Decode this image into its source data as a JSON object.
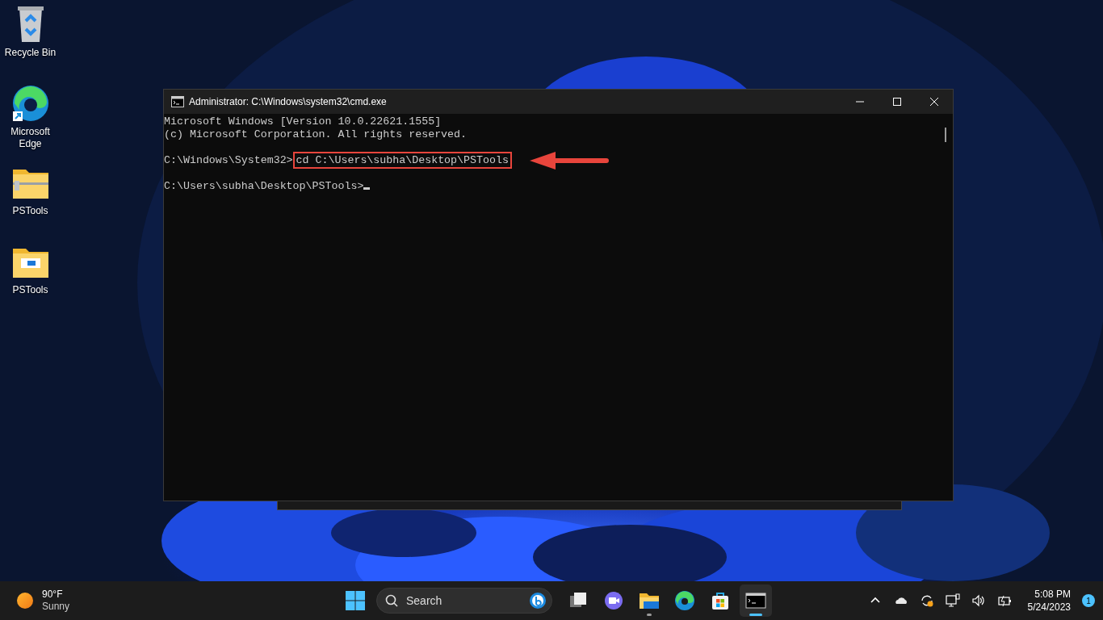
{
  "desktop_icons": [
    {
      "label": "Recycle Bin",
      "kind": "recycle"
    },
    {
      "label": "Microsoft Edge",
      "kind": "edge"
    },
    {
      "label": "PSTools",
      "kind": "zip"
    },
    {
      "label": "PSTools",
      "kind": "folder"
    }
  ],
  "console_window": {
    "title": "Administrator: C:\\Windows\\system32\\cmd.exe",
    "lines": [
      {
        "kind": "output",
        "text": "Microsoft Windows [Version 10.0.22621.1555]"
      },
      {
        "kind": "output",
        "text": "(c) Microsoft Corporation. All rights reserved."
      },
      {
        "kind": "blank"
      },
      {
        "kind": "command",
        "prompt": "C:\\Windows\\System32>",
        "command": "cd C:\\Users\\subha\\Desktop\\PSTools",
        "highlighted": true
      },
      {
        "kind": "blank"
      },
      {
        "kind": "prompt",
        "prompt": "C:\\Users\\subha\\Desktop\\PSTools>",
        "cursor": true
      }
    ]
  },
  "taskbar": {
    "weather": {
      "temperature": "90°F",
      "condition": "Sunny"
    },
    "search": {
      "placeholder": "Search"
    },
    "apps": [
      {
        "kind": "taskview",
        "active": false,
        "running": false
      },
      {
        "kind": "chat",
        "active": false,
        "running": false
      },
      {
        "kind": "explorer",
        "active": false,
        "running": true
      },
      {
        "kind": "edge",
        "active": false,
        "running": false
      },
      {
        "kind": "store",
        "active": false,
        "running": false
      },
      {
        "kind": "terminal",
        "active": true,
        "running": true
      }
    ],
    "tray": [
      {
        "kind": "chevron"
      },
      {
        "kind": "cloud"
      },
      {
        "kind": "sync"
      },
      {
        "kind": "network"
      },
      {
        "kind": "volume"
      },
      {
        "kind": "battery"
      }
    ],
    "clock": {
      "time": "5:08 PM",
      "date": "5/24/2023"
    },
    "notification_count": "1"
  }
}
